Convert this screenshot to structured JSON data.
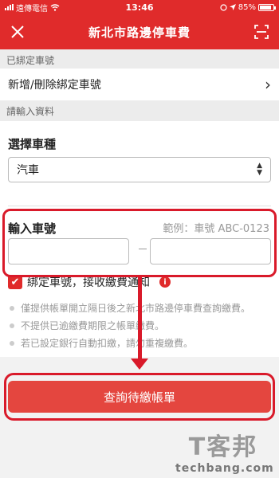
{
  "status_bar": {
    "carrier": "遠傳電信",
    "time": "13:46",
    "battery": "85%",
    "battery_level": 0.85
  },
  "app_bar": {
    "title": "新北市路邊停車費",
    "close_icon": "close-icon",
    "scan_icon": "scan-icon"
  },
  "sections": {
    "bound_plates_header": "已綁定車號",
    "input_header": "請輸入資料"
  },
  "bind_link": {
    "label": "新增/刪除綁定車號",
    "chevron": "›"
  },
  "vehicle_type": {
    "label": "選擇車種",
    "selected": "汽車"
  },
  "plate": {
    "label": "輸入車號",
    "hint": "範例：車號 ABC-0123",
    "part1_value": "",
    "part2_value": ""
  },
  "bind_checkbox": {
    "checked": true,
    "label": "綁定車號，接收繳費通知"
  },
  "notes": [
    "僅提供帳單開立隔日後之新北市路邊停車費查詢繳費。",
    "不提供已逾繳費期限之帳單繳費。",
    "若已設定銀行自動扣繳，請勿重複繳費。"
  ],
  "submit": {
    "label": "查詢待繳帳單"
  },
  "watermark": {
    "zh": "T客邦",
    "en": "techbang.com"
  },
  "colors": {
    "brand_red": "#e02b2b",
    "highlight_red": "#d91a2a",
    "button_red": "#e4463f"
  }
}
